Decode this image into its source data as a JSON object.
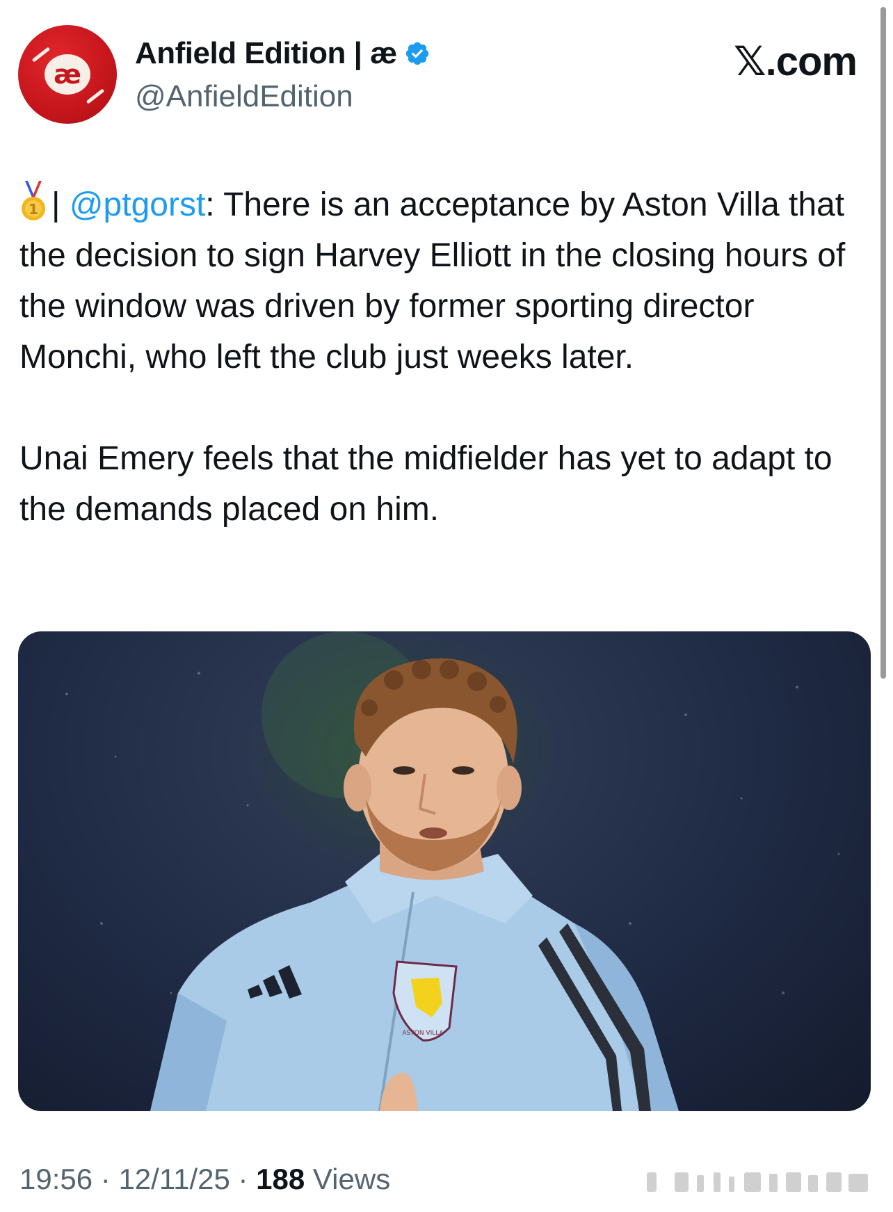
{
  "brand": {
    "label": "𝕏.com"
  },
  "author": {
    "display_name": "Anfield Edition | æ",
    "handle": "@AnfieldEdition",
    "avatar_glyph": "æ",
    "verified": true,
    "accent_color": "#c4161c"
  },
  "tweet": {
    "mention": "@ptgorst",
    "separator": "|",
    "paragraph1_rest": ": There is an acceptance by Aston Villa that the decision to sign Harvey Elliott in the closing hours of the window was driven by former sporting director Monchi, who left the club just weeks later.",
    "paragraph2": "Unai Emery feels that the midfielder has yet to adapt to the demands placed on him.",
    "link_color": "#1d9bf0"
  },
  "media": {
    "kit_brand_icon": "adidas-logo-icon",
    "crest_text": "ASTON VILLA"
  },
  "footer": {
    "time": "19:56",
    "dot": "·",
    "date": "12/11/25",
    "views_count": "188",
    "views_label": "Views"
  }
}
